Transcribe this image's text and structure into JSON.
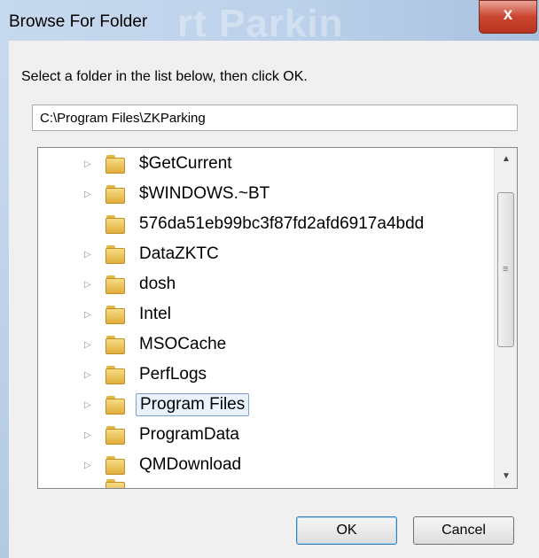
{
  "window": {
    "title": "Browse For Folder",
    "ghost_text": "rt Parkin",
    "close_glyph": "x"
  },
  "instruction": "Select a folder in the list below, then click OK.",
  "path_value": "C:\\Program Files\\ZKParking",
  "tree": {
    "items": [
      {
        "label": "$GetCurrent",
        "expandable": true
      },
      {
        "label": "$WINDOWS.~BT",
        "expandable": true
      },
      {
        "label": "576da51eb99bc3f87fd2afd6917a4bdd",
        "expandable": false
      },
      {
        "label": "DataZKTC",
        "expandable": true
      },
      {
        "label": "dosh",
        "expandable": true
      },
      {
        "label": "Intel",
        "expandable": true
      },
      {
        "label": "MSOCache",
        "expandable": true
      },
      {
        "label": "PerfLogs",
        "expandable": true
      },
      {
        "label": "Program Files",
        "expandable": true,
        "selected": true
      },
      {
        "label": "ProgramData",
        "expandable": true
      },
      {
        "label": "QMDownload",
        "expandable": true
      }
    ],
    "scrollbar": {
      "up": "▲",
      "down": "▼",
      "grip": "≡"
    }
  },
  "buttons": {
    "ok": "OK",
    "cancel": "Cancel"
  },
  "icons": {
    "expand": "▷"
  }
}
